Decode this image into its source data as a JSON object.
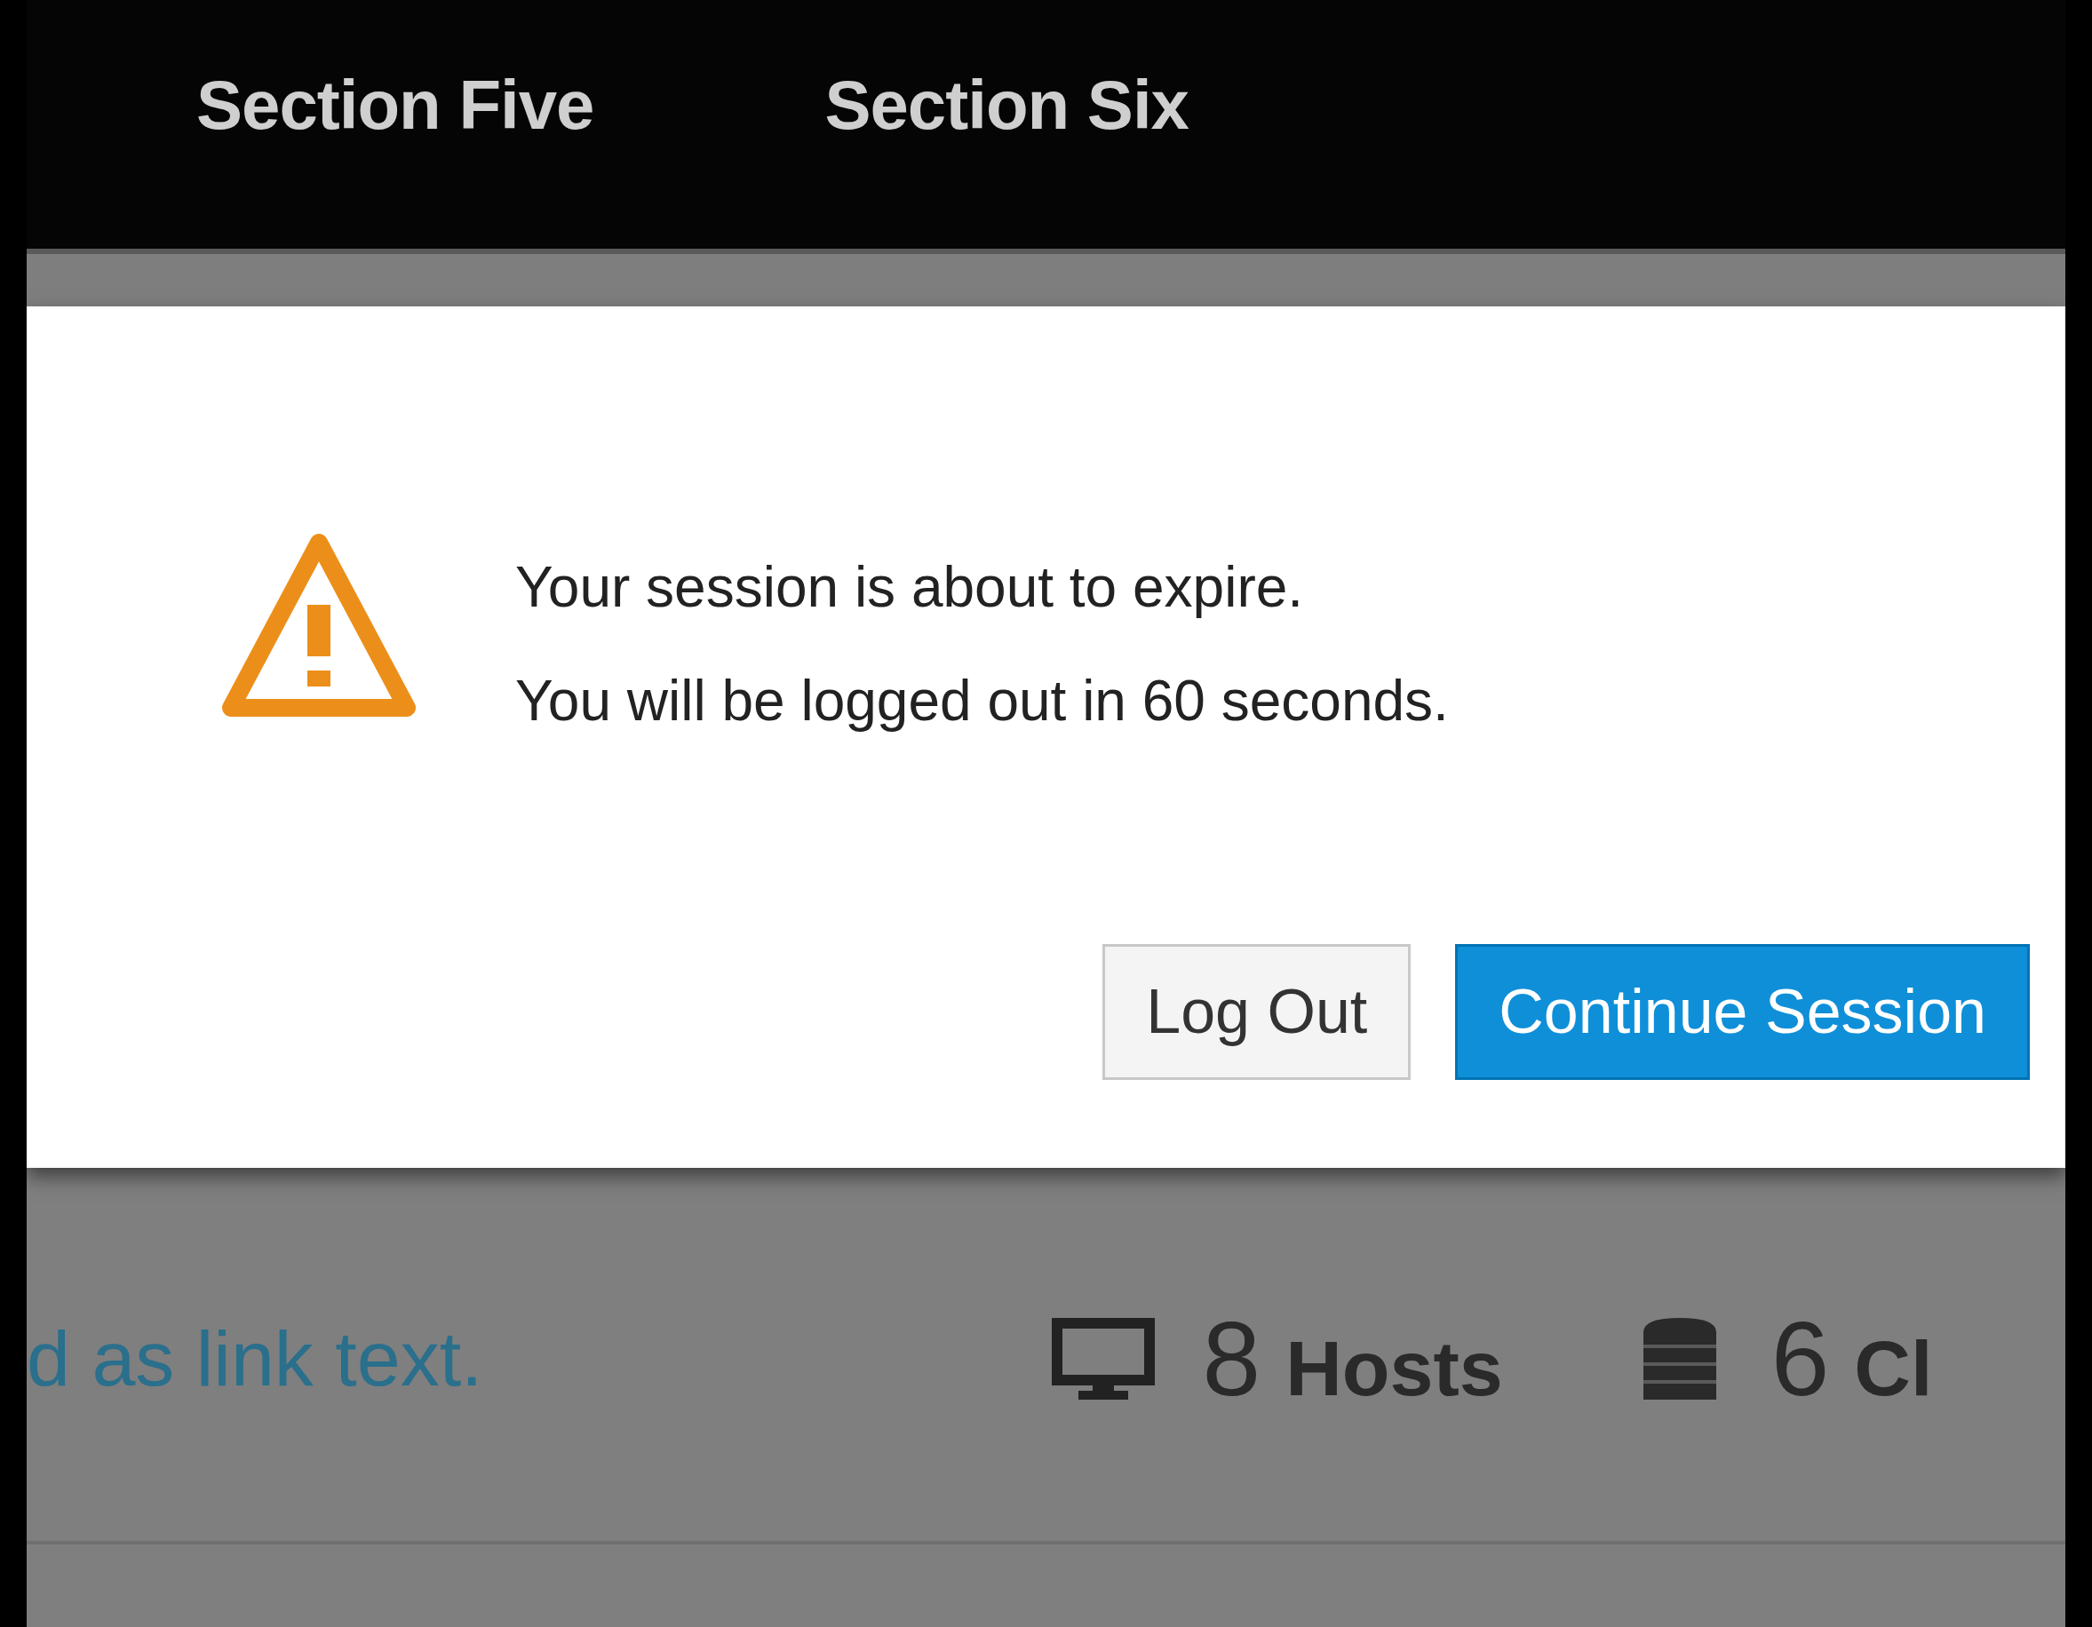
{
  "nav": {
    "items": [
      "Section Five",
      "Section Six"
    ]
  },
  "modal": {
    "lines": [
      "Your session is about to expire.",
      "You will be logged out in 60 seconds."
    ],
    "buttons": [
      {
        "label": "Log Out",
        "kind": "default"
      },
      {
        "label": "Continue Session",
        "kind": "primary"
      }
    ]
  },
  "background": {
    "link_text": "d as link text.",
    "stats": [
      {
        "kind": "hosts",
        "count": "8",
        "label": "Hosts"
      },
      {
        "kind": "clusters",
        "count": "6",
        "label": "Cl"
      }
    ]
  }
}
